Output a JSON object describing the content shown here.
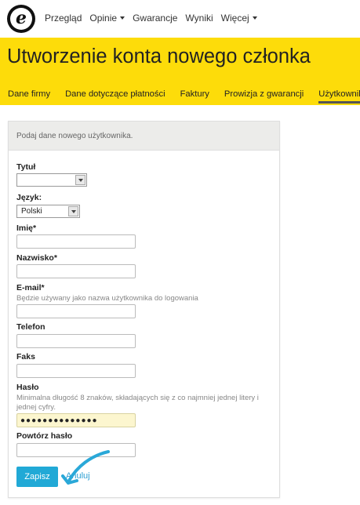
{
  "nav": {
    "logo_letter": "e",
    "items": [
      {
        "label": "Przegląd",
        "dropdown": false
      },
      {
        "label": "Opinie",
        "dropdown": true
      },
      {
        "label": "Gwarancje",
        "dropdown": false
      },
      {
        "label": "Wyniki",
        "dropdown": false
      },
      {
        "label": "Więcej",
        "dropdown": true
      }
    ]
  },
  "header": {
    "title": "Utworzenie konta nowego członka",
    "tabs": [
      {
        "label": "Dane firmy",
        "active": false
      },
      {
        "label": "Dane dotyczące płatności",
        "active": false
      },
      {
        "label": "Faktury",
        "active": false
      },
      {
        "label": "Prowizja z gwarancji",
        "active": false
      },
      {
        "label": "Użytkownik",
        "active": true
      }
    ],
    "background": "#fddc0a"
  },
  "form": {
    "intro": "Podaj dane nowego użytkownika.",
    "title_label": "Tytuł",
    "title_value": "",
    "language_label": "Język:",
    "language_value": "Polski",
    "first_name_label": "Imię*",
    "first_name_value": "",
    "last_name_label": "Nazwisko*",
    "last_name_value": "",
    "email_label": "E-mail*",
    "email_hint": "Będzie używany jako nazwa użytkownika do logowania",
    "email_value": "",
    "phone_label": "Telefon",
    "phone_value": "",
    "fax_label": "Faks",
    "fax_value": "",
    "password_label": "Hasło",
    "password_hint": "Minimalna długość 8 znaków, składających się z co najmniej jednej litery i jednej cyfry.",
    "password_value": "●●●●●●●●●●●●●●",
    "password_repeat_label": "Powtórz hasło",
    "password_repeat_value": "",
    "save_label": "Zapisz",
    "cancel_label": "Anuluj"
  },
  "colors": {
    "accent": "#21a9d6",
    "link": "#2c9fd2",
    "password_fill": "#fcf6cf"
  },
  "icons": {
    "logo": "trusted-shops-e-logo",
    "annotation": "curved-arrow-icon"
  }
}
